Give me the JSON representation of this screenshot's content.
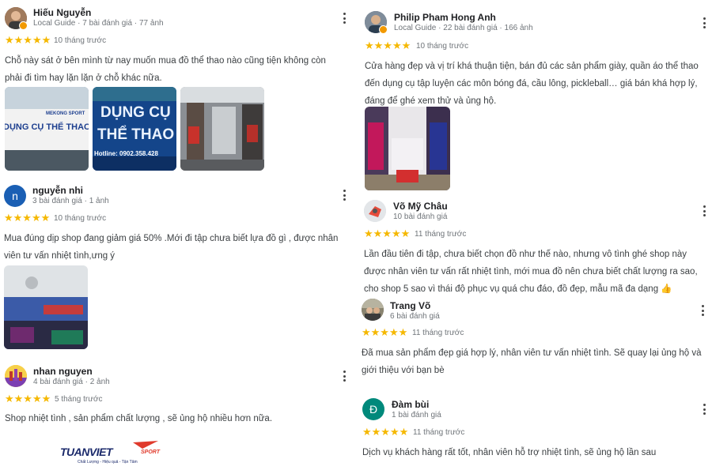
{
  "colors": {
    "star": "#f5b800",
    "guide_badge": "#f29900",
    "avatar_n": "#1a5fb4",
    "avatar_d": "#00897b"
  },
  "icons": {
    "more": "more-vert-icon",
    "star": "star-icon",
    "guide": "local-guide-badge-icon"
  },
  "reviews": [
    {
      "name": "Hiếu Nguyễn",
      "meta": "Local Guide · 7 bài đánh giá · 77 ảnh",
      "stars": "★★★★★",
      "rating": 5,
      "time": "10 tháng trước",
      "text": "Chỗ này sát ở bên mình từ nay muốn mua đồ thể thao nào cũng tiện không còn phải đi tìm hay lặn lặn ở chỗ khác nữa.",
      "photos": [
        {
          "caption_top": "MEKONG SPORT",
          "caption_main": "DỤNG CỤ THỂ THAO"
        },
        {
          "caption_top": "DỤNG CỤ",
          "caption_main": "THỂ THAO",
          "caption_sub": "Hotline: 0902.358.428"
        },
        {
          "caption_top": ""
        }
      ]
    },
    {
      "name": "nguyễn nhi",
      "avatar_letter": "n",
      "meta": "3 bài đánh giá · 1 ảnh",
      "stars": "★★★★★",
      "rating": 5,
      "time": "10 tháng trước",
      "text": "Mua đúng dịp shop đang giảm giá 50% .Mới đi tập chưa biết lựa đồ gì , được nhân viên tư vấn nhiệt tình,ưng ý"
    },
    {
      "name": "nhan nguyen",
      "meta": "4 bài đánh giá · 2 ảnh",
      "stars": "★★★★★",
      "rating": 5,
      "time": "5 tháng trước",
      "text": "Shop nhiệt tình , sản phẩm chất lượng , sẽ ủng hộ nhiều hơn nữa."
    },
    {
      "name": "Philip Pham Hong Anh",
      "meta": "Local Guide · 22 bài đánh giá · 166 ảnh",
      "stars": "★★★★★",
      "rating": 5,
      "time": "10 tháng trước",
      "text": "Cửa hàng đẹp và vị trí khá thuận tiện, bán đủ các sản phẩm giày, quần áo thể thao đến dụng cụ tập luyện các môn bóng đá, cầu lông, pickleball… giá bán khá hợp lý, đáng để ghé xem thử và ủng hộ."
    },
    {
      "name": "Võ Mỹ Châu",
      "meta": "10 bài đánh giá",
      "stars": "★★★★★",
      "rating": 5,
      "time": "11 tháng trước",
      "text": "Lần đầu tiên đi tập, chưa biết chọn đồ như thế nào, nhưng vô tình ghé shop này được nhân viên tư vấn rất nhiệt tình, mới mua đồ nên chưa biết chất lượng ra sao, cho shop 5 sao vì thái độ phục vụ quá chu đáo, đồ đẹp, mẫu mã đa dạng 👍"
    },
    {
      "name": "Trang Võ",
      "meta": "6 bài đánh giá",
      "stars": "★★★★★",
      "rating": 5,
      "time": "11 tháng trước",
      "text": "Đã mua sản phẩm đẹp giá hợp lý, nhân viên tư vấn nhiệt tình. Sẽ quay lại ủng hộ và giới thiệu với bạn bè"
    },
    {
      "name": "Đàm bùi",
      "avatar_letter": "Đ",
      "meta": "1 bài đánh giá",
      "stars": "★★★★★",
      "rating": 5,
      "time": "11 tháng trước",
      "text": "Dịch vụ khách hàng rất tốt, nhân viên hỗ trợ nhiệt tình, sẽ ủng hộ lần sau"
    }
  ],
  "logo": {
    "brand": "TUANVIET",
    "brand_sub": "SPORT",
    "tagline": "Chất Lượng - Hiệu quả - Tận Tâm"
  }
}
